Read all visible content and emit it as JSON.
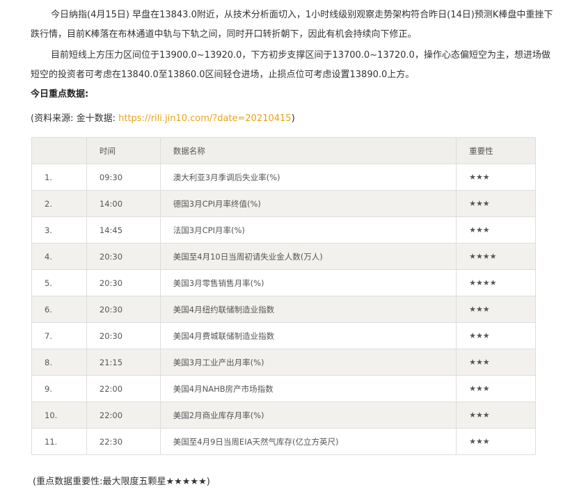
{
  "article": {
    "paragraph_1": "今日纳指(4月15日) 早盘在13843.0附近，从技术分析面切入，1小时线级别观察走势架构符合昨日(14日)预测K棒盘中重挫下跌行情，目前K棒落在布林通道中轨与下轨之间，同时开口转折朝下，因此有机会持续向下修正。",
    "paragraph_2": "目前短线上方压力区间位于13900.0~13920.0，下方初步支撑区间于13700.0~13720.0，操作心态偏短空为主，想进场做短空的投资者可考虑在13840.0至13860.0区间轻仓进场，止损点位可考虑设置13890.0上方。",
    "heading": "今日重点数据:",
    "source_prefix": "(资料来源: 金十数据: ",
    "source_link": "https://rili.jin10.com/?date=20210415",
    "source_suffix": ")",
    "footnote": "(重点数据重要性:最大限度五颗星★★★★★)"
  },
  "table": {
    "headers": [
      "",
      "时间",
      "数据名称",
      "重要性"
    ],
    "rows": [
      {
        "idx": "1.",
        "time": "09:30",
        "name": "澳大利亚3月季调后失业率(%)",
        "importance": "★★★"
      },
      {
        "idx": "2.",
        "time": "14:00",
        "name": "德国3月CPI月率终值(%)",
        "importance": "★★★"
      },
      {
        "idx": "3.",
        "time": "14:45",
        "name": "法国3月CPI月率(%)",
        "importance": "★★★"
      },
      {
        "idx": "4.",
        "time": "20:30",
        "name": "美国至4月10日当周初请失业金人数(万人)",
        "importance": "★★★★"
      },
      {
        "idx": "5.",
        "time": "20:30",
        "name": "美国3月零售销售月率(%)",
        "importance": "★★★★"
      },
      {
        "idx": "6.",
        "time": "20:30",
        "name": "美国4月纽约联储制造业指数",
        "importance": "★★★"
      },
      {
        "idx": "7.",
        "time": "20:30",
        "name": "美国4月费城联储制造业指数",
        "importance": "★★★"
      },
      {
        "idx": "8.",
        "time": "21:15",
        "name": "美国3月工业产出月率(%)",
        "importance": "★★★"
      },
      {
        "idx": "9.",
        "time": "22:00",
        "name": "美国4月NAHB房产市场指数",
        "importance": "★★★"
      },
      {
        "idx": "10.",
        "time": "22:00",
        "name": "美国2月商业库存月率(%)",
        "importance": "★★★"
      },
      {
        "idx": "11.",
        "time": "22:30",
        "name": "美国至4月9日当周EIA天然气库存(亿立方英尺)",
        "importance": "★★★"
      }
    ]
  },
  "colors": {
    "link": "#e8a317",
    "header_bg": "#f0efeb",
    "stripe_bg": "#f2f1ee",
    "border": "#dddddd"
  }
}
